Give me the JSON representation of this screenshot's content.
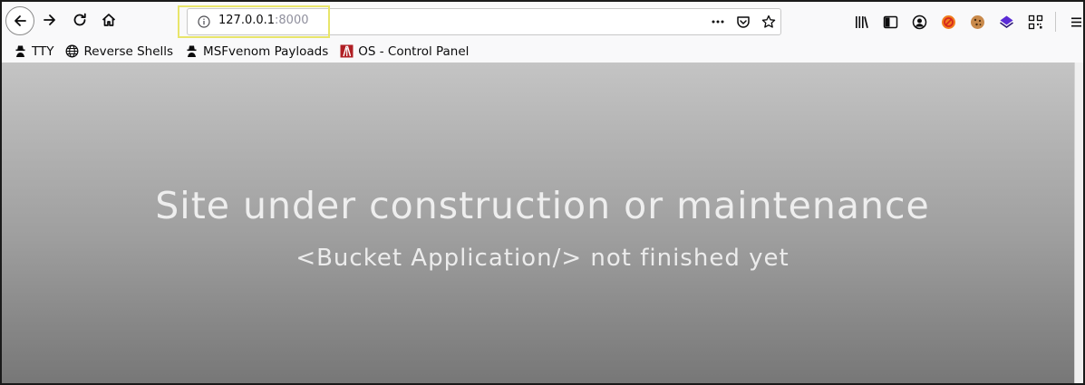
{
  "browser": {
    "url": {
      "host": "127.0.0.1",
      "port": ":8000"
    },
    "nav_icons": [
      "back-icon",
      "forward-icon",
      "reload-icon",
      "home-icon"
    ],
    "url_icons": [
      "site-info-icon",
      "page-actions-icon",
      "pocket-icon",
      "bookmark-star-icon"
    ],
    "toolbar_icons": [
      "library-icon",
      "sidebar-icon",
      "account-icon",
      "extension-blocked-icon",
      "cookie-icon",
      "stack-extension-icon",
      "qr-code-icon",
      "hamburger-menu-icon"
    ]
  },
  "bookmarks": [
    {
      "label": "TTY",
      "icon": "hacker-icon"
    },
    {
      "label": "Reverse Shells",
      "icon": "globe-icon"
    },
    {
      "label": "MSFvenom Payloads",
      "icon": "hacker-icon"
    },
    {
      "label": "OS - Control Panel",
      "icon": "control-panel-icon"
    }
  ],
  "page": {
    "headline": "Site under construction or maintenance",
    "subline": "<Bucket Application/> not finished yet"
  },
  "colors": {
    "gradient_top": "#c4c4c4",
    "gradient_bottom": "#777777",
    "url_highlight": "#e8e56a"
  }
}
